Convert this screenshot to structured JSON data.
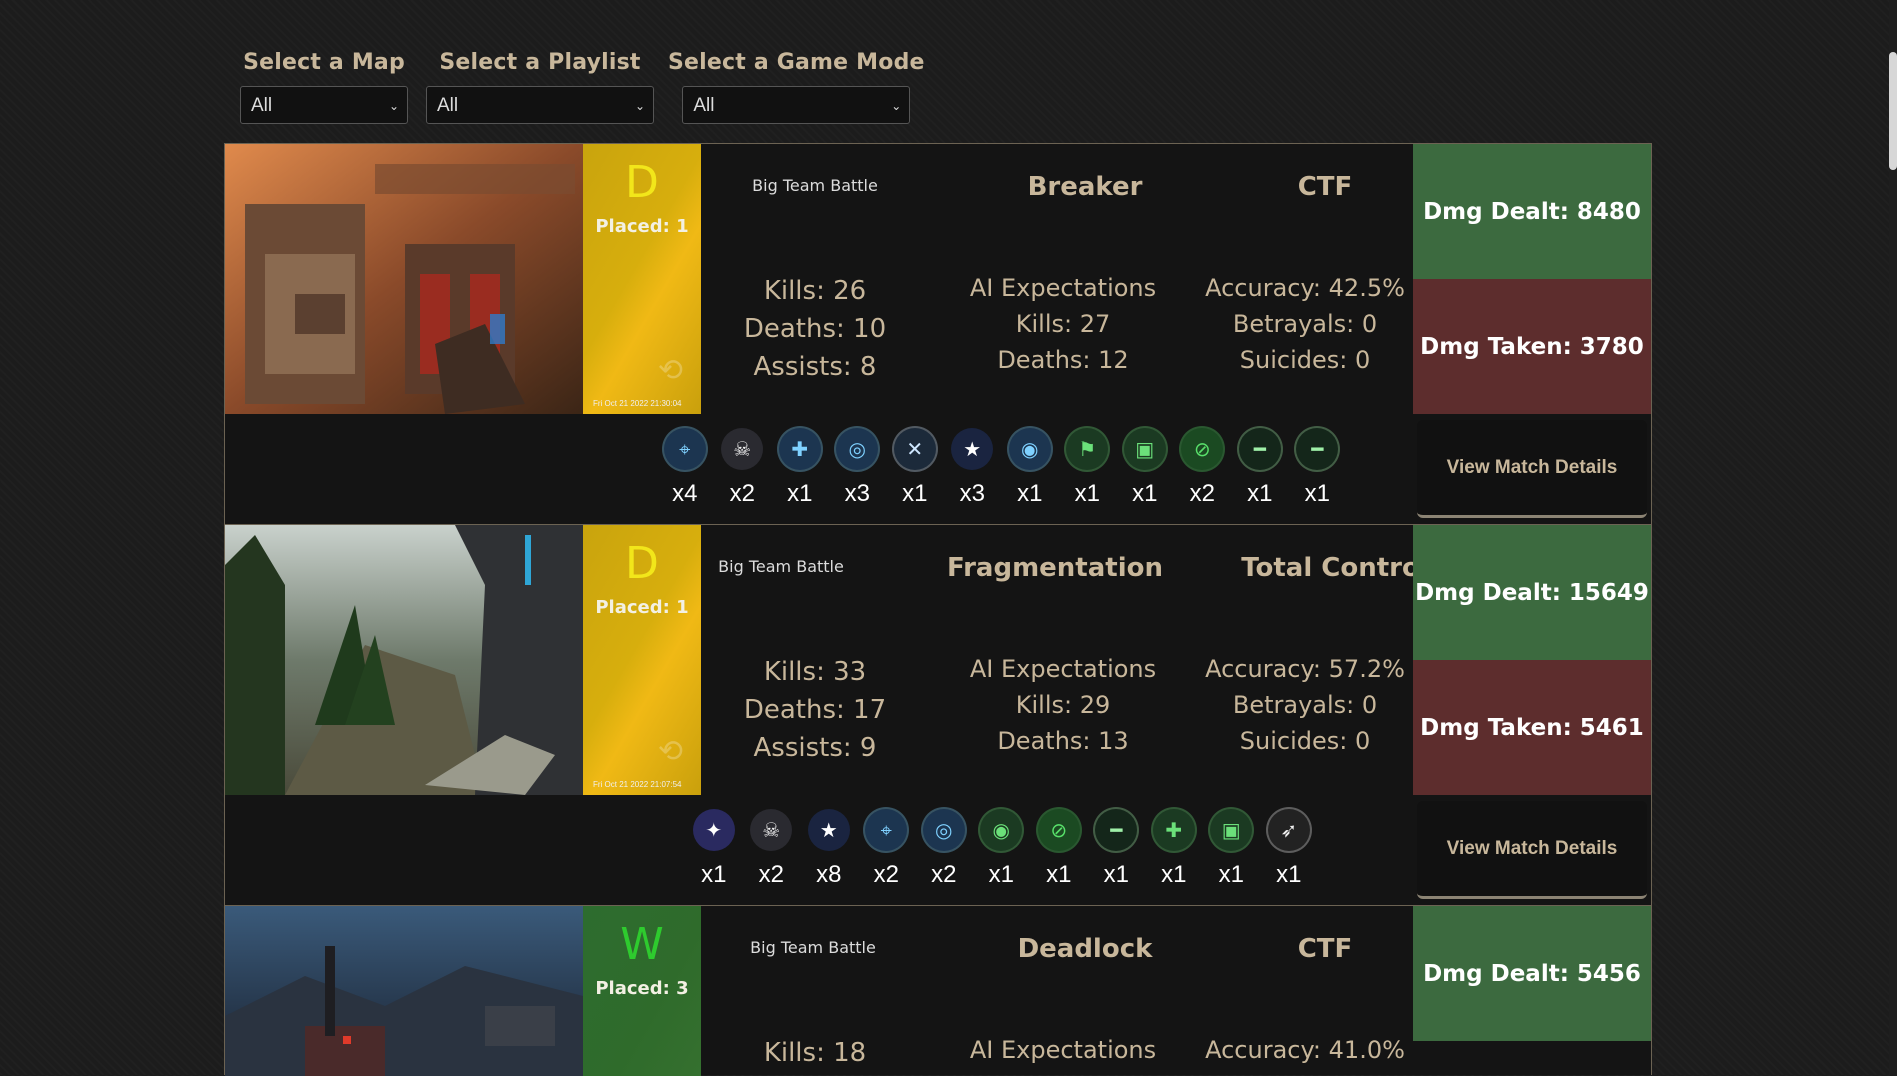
{
  "filters": [
    {
      "label": "Select a Map",
      "value": "All"
    },
    {
      "label": "Select a Playlist",
      "value": "All"
    },
    {
      "label": "Select a Game Mode",
      "value": "All"
    }
  ],
  "matches": [
    {
      "outcome": "D",
      "placed": "Placed: 1",
      "date": "Fri Oct 21 2022 21:30:04",
      "playlist": "Big Team Battle",
      "map": "Breaker",
      "mode": "CTF",
      "kills": "Kills: 26",
      "deaths": "Deaths: 10",
      "assists": "Assists: 8",
      "ai_title": "AI Expectations",
      "ai_kills": "Kills: 27",
      "ai_deaths": "Deaths: 12",
      "accuracy": "Accuracy: 42.5%",
      "betrayals": "Betrayals: 0",
      "suicides": "Suicides: 0",
      "dmg_dealt": "Dmg Dealt: 8480",
      "dmg_taken": "Dmg Taken: 3780",
      "view_label": "View Match Details",
      "medals": [
        {
          "icon": "reticle-icon",
          "glyph": "⌖",
          "count": "x4"
        },
        {
          "icon": "skull-icon",
          "glyph": "☠",
          "count": "x2"
        },
        {
          "icon": "grenade-icon",
          "glyph": "✚",
          "count": "x1"
        },
        {
          "icon": "target-icon",
          "glyph": "◎",
          "count": "x3"
        },
        {
          "icon": "crossed-blades-icon",
          "glyph": "✕",
          "count": "x1"
        },
        {
          "icon": "star-icon",
          "glyph": "★",
          "count": "x3"
        },
        {
          "icon": "helmet-icon",
          "glyph": "◉",
          "count": "x1"
        },
        {
          "icon": "flag-icon",
          "glyph": "⚑",
          "count": "x1"
        },
        {
          "icon": "vehicle-icon",
          "glyph": "▣",
          "count": "x1"
        },
        {
          "icon": "no-scope-icon",
          "glyph": "⊘",
          "count": "x2"
        },
        {
          "icon": "sniper-rifle-icon",
          "glyph": "━",
          "count": "x1"
        },
        {
          "icon": "rifle-icon",
          "glyph": "━",
          "count": "x1"
        }
      ]
    },
    {
      "outcome": "D",
      "placed": "Placed: 1",
      "date": "Fri Oct 21 2022 21:07:54",
      "playlist": "Big Team Battle",
      "map": "Fragmentation",
      "mode": "Total Control",
      "kills": "Kills: 33",
      "deaths": "Deaths: 17",
      "assists": "Assists: 9",
      "ai_title": "AI Expectations",
      "ai_kills": "Kills: 29",
      "ai_deaths": "Deaths: 13",
      "accuracy": "Accuracy: 57.2%",
      "betrayals": "Betrayals: 0",
      "suicides": "Suicides: 0",
      "dmg_dealt": "Dmg Dealt: 15649",
      "dmg_taken": "Dmg Taken: 5461",
      "view_label": "View Match Details",
      "medals": [
        {
          "icon": "triple-star-icon",
          "glyph": "✦",
          "count": "x1"
        },
        {
          "icon": "skull-icon",
          "glyph": "☠",
          "count": "x2"
        },
        {
          "icon": "star-icon",
          "glyph": "★",
          "count": "x8"
        },
        {
          "icon": "reticle-icon",
          "glyph": "⌖",
          "count": "x2"
        },
        {
          "icon": "target-icon",
          "glyph": "◎",
          "count": "x2"
        },
        {
          "icon": "winged-helmet-icon",
          "glyph": "◉",
          "count": "x1"
        },
        {
          "icon": "no-scope-icon",
          "glyph": "⊘",
          "count": "x1"
        },
        {
          "icon": "rifle-icon",
          "glyph": "━",
          "count": "x1"
        },
        {
          "icon": "diamond-cross-icon",
          "glyph": "✚",
          "count": "x1"
        },
        {
          "icon": "vehicle-icon",
          "glyph": "▣",
          "count": "x1"
        },
        {
          "icon": "blade-icon",
          "glyph": "➶",
          "count": "x1"
        }
      ]
    },
    {
      "outcome": "W",
      "placed": "Placed: 3",
      "playlist": "Big Team Battle",
      "map": "Deadlock",
      "mode": "CTF",
      "kills": "Kills: 18",
      "ai_title": "AI Expectations",
      "accuracy": "Accuracy: 41.0%",
      "dmg_dealt": "Dmg Dealt: 5456"
    }
  ]
}
